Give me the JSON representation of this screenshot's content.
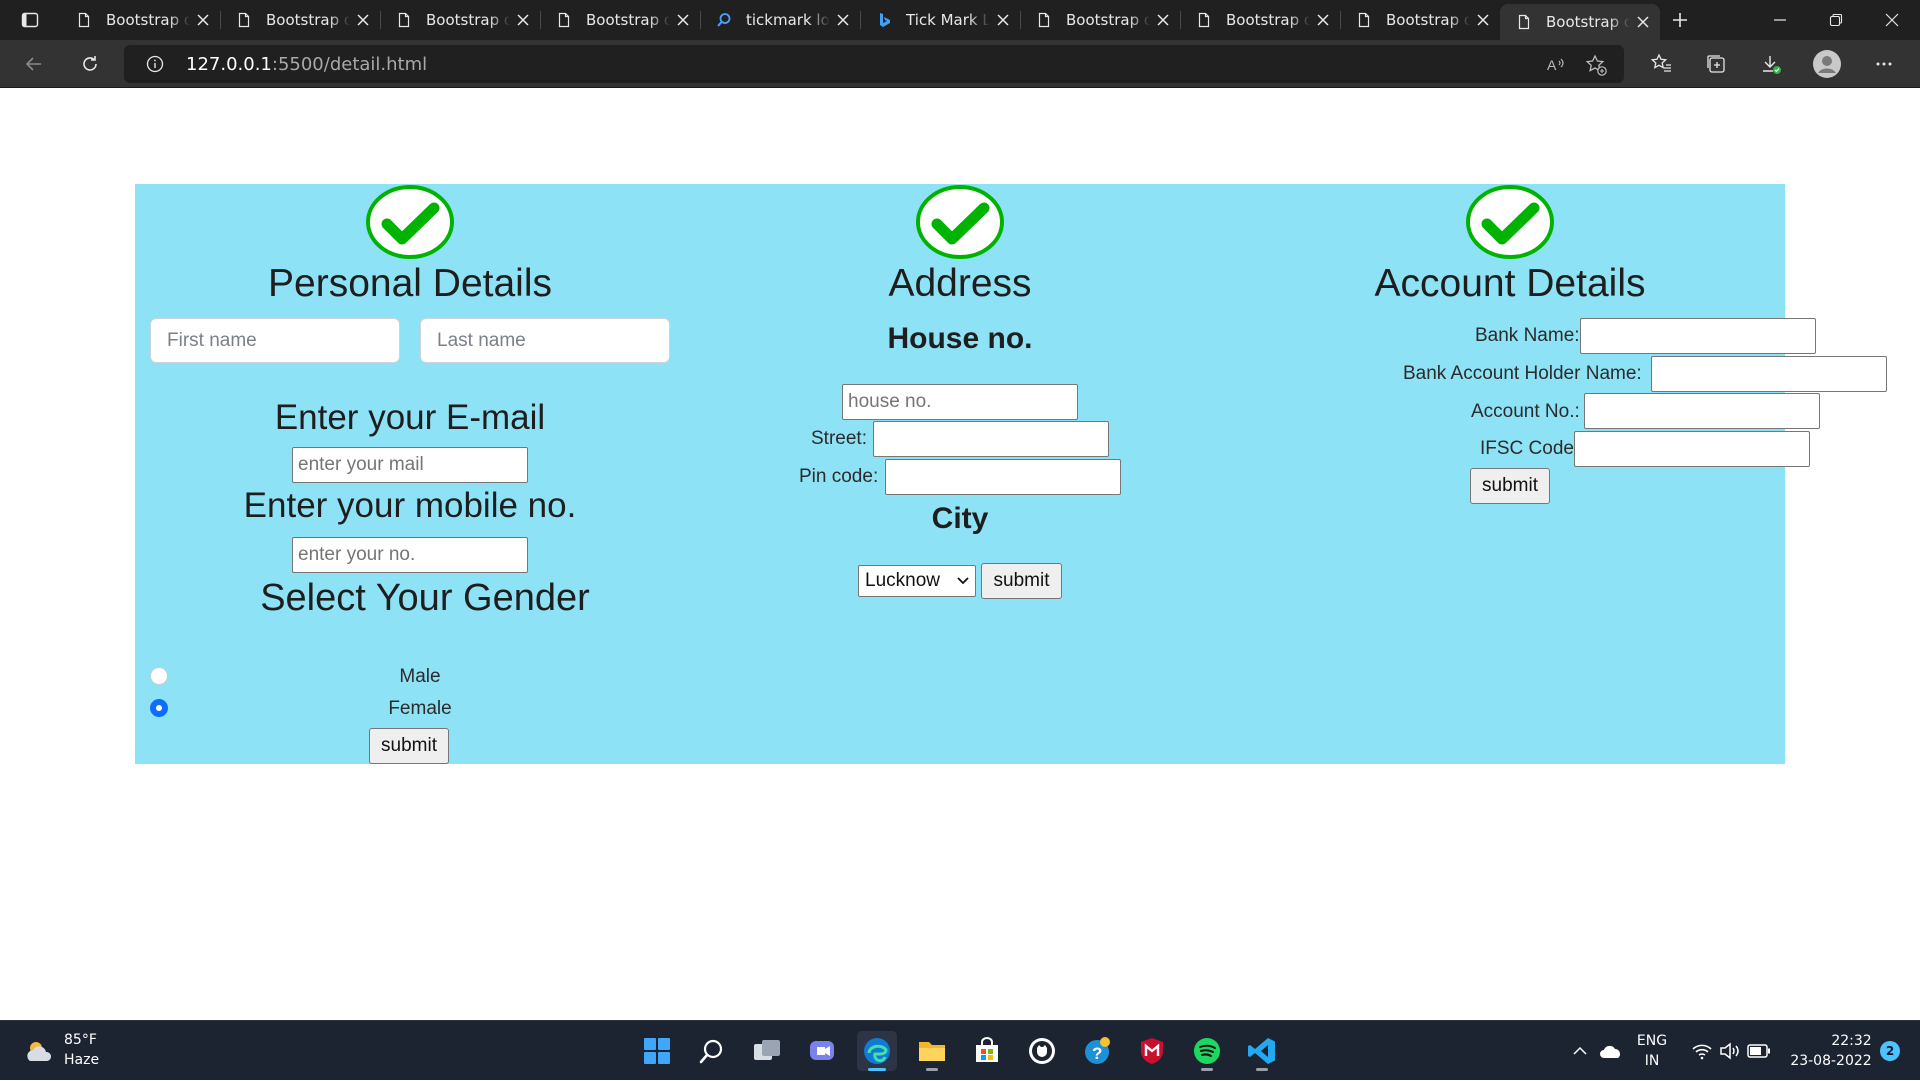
{
  "browser": {
    "tabs": [
      {
        "title": "Bootstrap demo",
        "icon": "page-icon",
        "active": false
      },
      {
        "title": "Bootstrap demo",
        "icon": "page-icon",
        "active": false
      },
      {
        "title": "Bootstrap demo",
        "icon": "page-icon",
        "active": false
      },
      {
        "title": "Bootstrap demo",
        "icon": "page-icon",
        "active": false
      },
      {
        "title": "tickmark logo",
        "icon": "search-icon",
        "active": false
      },
      {
        "title": "Tick Mark Logo",
        "icon": "bing-icon",
        "active": false
      },
      {
        "title": "Bootstrap demo",
        "icon": "page-icon",
        "active": false
      },
      {
        "title": "Bootstrap demo",
        "icon": "page-icon",
        "active": false
      },
      {
        "title": "Bootstrap demo",
        "icon": "page-icon",
        "active": false
      },
      {
        "title": "Bootstrap demo",
        "icon": "page-icon",
        "active": true
      }
    ],
    "url_host": "127.0.0.1",
    "url_rest": ":5500/detail.html"
  },
  "personal": {
    "heading": "Personal Details",
    "first_name_placeholder": "First name",
    "last_name_placeholder": "Last name",
    "email_heading": "Enter your E-mail",
    "email_placeholder": "enter your mail",
    "mobile_heading": "Enter your mobile no.",
    "mobile_placeholder": "enter your no.",
    "gender_heading": "Select Your Gender",
    "gender_options": [
      {
        "label": "Male",
        "checked": false
      },
      {
        "label": "Female",
        "checked": true
      }
    ],
    "submit_label": "submit"
  },
  "address": {
    "heading": "Address",
    "house_heading": "House no.",
    "house_placeholder": "house no.",
    "street_label": "Street:",
    "pincode_label": "Pin code:",
    "city_heading": "City",
    "city_selected": "Lucknow",
    "submit_label": "submit"
  },
  "account": {
    "heading": "Account Details",
    "bank_name_label": "Bank Name:",
    "holder_label": "Bank Account Holder Name:",
    "account_no_label": "Account No.:",
    "ifsc_label": "IFSC Code:",
    "submit_label": "submit"
  },
  "taskbar": {
    "weather_temp": "85°F",
    "weather_cond": "Haze",
    "lang_line1": "ENG",
    "lang_line2": "IN",
    "time": "22:32",
    "date": "23-08-2022",
    "notifications": "2"
  },
  "colors": {
    "panel_bg": "#8ee2f6",
    "check_green": "#00b300",
    "radio_blue": "#0d6efd"
  }
}
